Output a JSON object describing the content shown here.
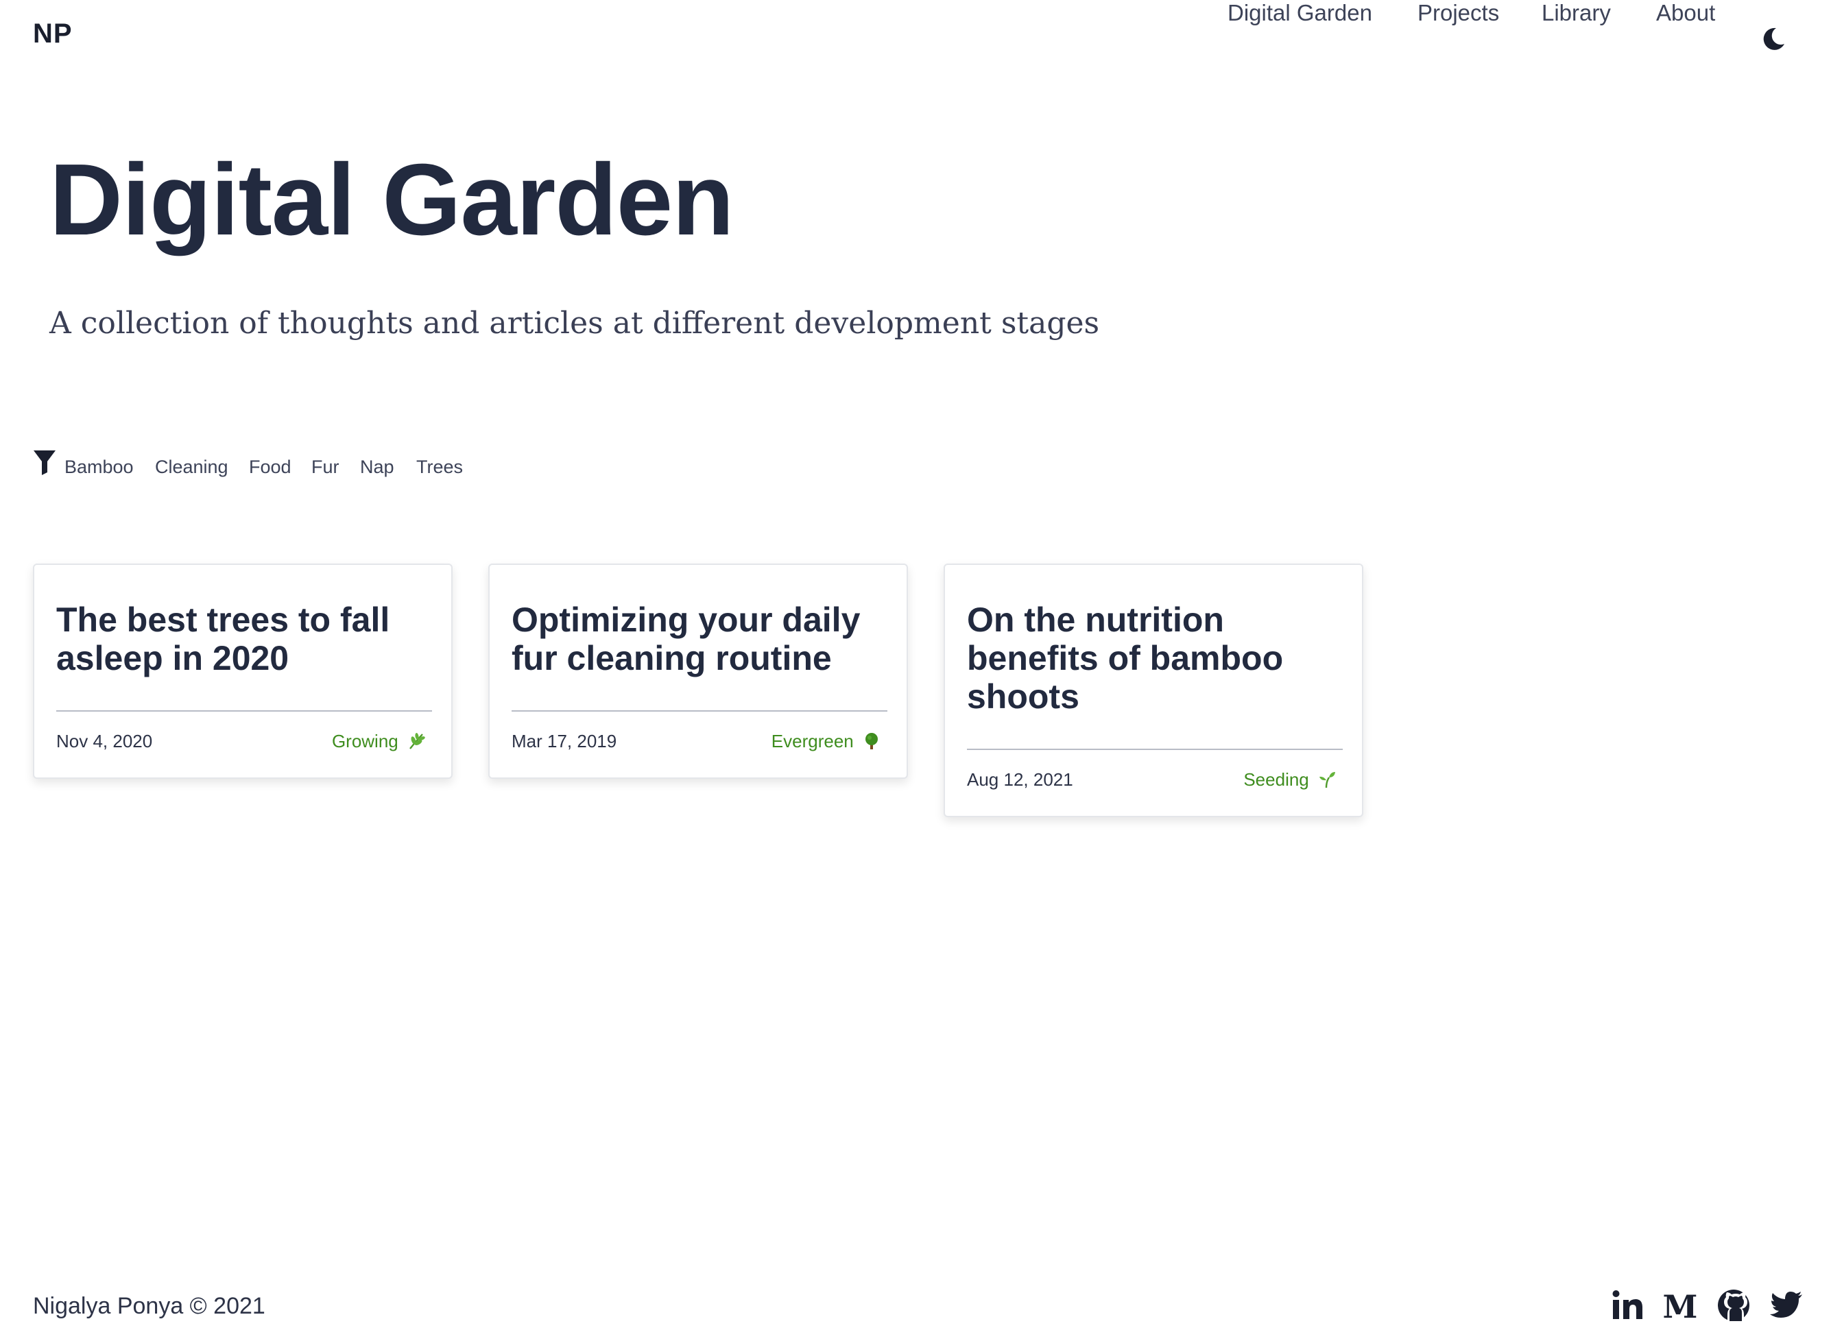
{
  "header": {
    "logo": "NP",
    "nav": [
      {
        "label": "Digital Garden"
      },
      {
        "label": "Projects"
      },
      {
        "label": "Library"
      },
      {
        "label": "About"
      }
    ],
    "theme_icon": "moon-icon"
  },
  "hero": {
    "title": "Digital Garden",
    "subtitle": "A collection of thoughts and articles at different development stages"
  },
  "filters": {
    "icon": "filter-icon",
    "tags": [
      "Bamboo",
      "Cleaning",
      "Food",
      "Fur",
      "Nap",
      "Trees"
    ]
  },
  "cards": [
    {
      "title": "The best trees to fall asleep in 2020",
      "date": "Nov 4, 2020",
      "stage": "Growing",
      "stage_icon": "herb-icon"
    },
    {
      "title": "Optimizing your daily fur cleaning routine",
      "date": "Mar 17, 2019",
      "stage": "Evergreen",
      "stage_icon": "tree-icon"
    },
    {
      "title": "On the nutrition benefits of bamboo shoots",
      "date": "Aug 12, 2021",
      "stage": "Seeding",
      "stage_icon": "seedling-icon"
    }
  ],
  "colors": {
    "text": "#222a3f",
    "stage_green": "#3f8d1f",
    "border": "#e4e6ea"
  },
  "footer": {
    "copyright": "Nigalya Ponya © 2021",
    "social": [
      "linkedin-icon",
      "medium-icon",
      "github-icon",
      "twitter-icon"
    ]
  }
}
